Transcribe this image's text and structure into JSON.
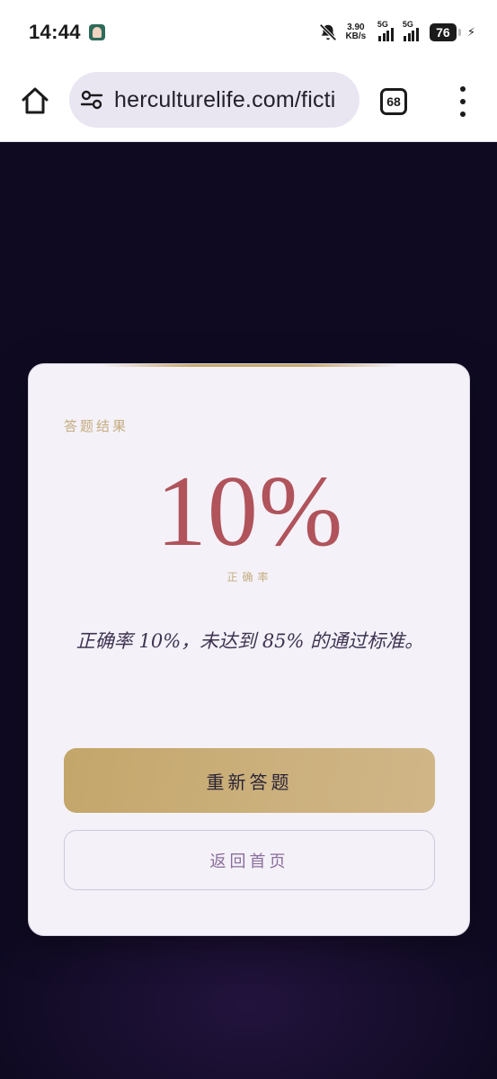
{
  "status_bar": {
    "time": "14:44",
    "net_speed_value": "3.90",
    "net_speed_unit": "KB/s",
    "signal_1_label": "5G",
    "signal_2_label": "5G",
    "battery_level": "76"
  },
  "browser": {
    "url": "herculturelife.com/ficti",
    "tab_count": "68"
  },
  "result": {
    "section_label": "答题结果",
    "score": "10%",
    "score_caption": "正确率",
    "message": "正确率 10%，未达到 85% 的通过标准。",
    "retry_button": "重新答题",
    "home_button": "返回首页"
  },
  "colors": {
    "page_background": "#0f0a22",
    "card_background": "#f4f1f8",
    "score_color": "#b0535b",
    "accent_gold": "#c8a96e"
  }
}
